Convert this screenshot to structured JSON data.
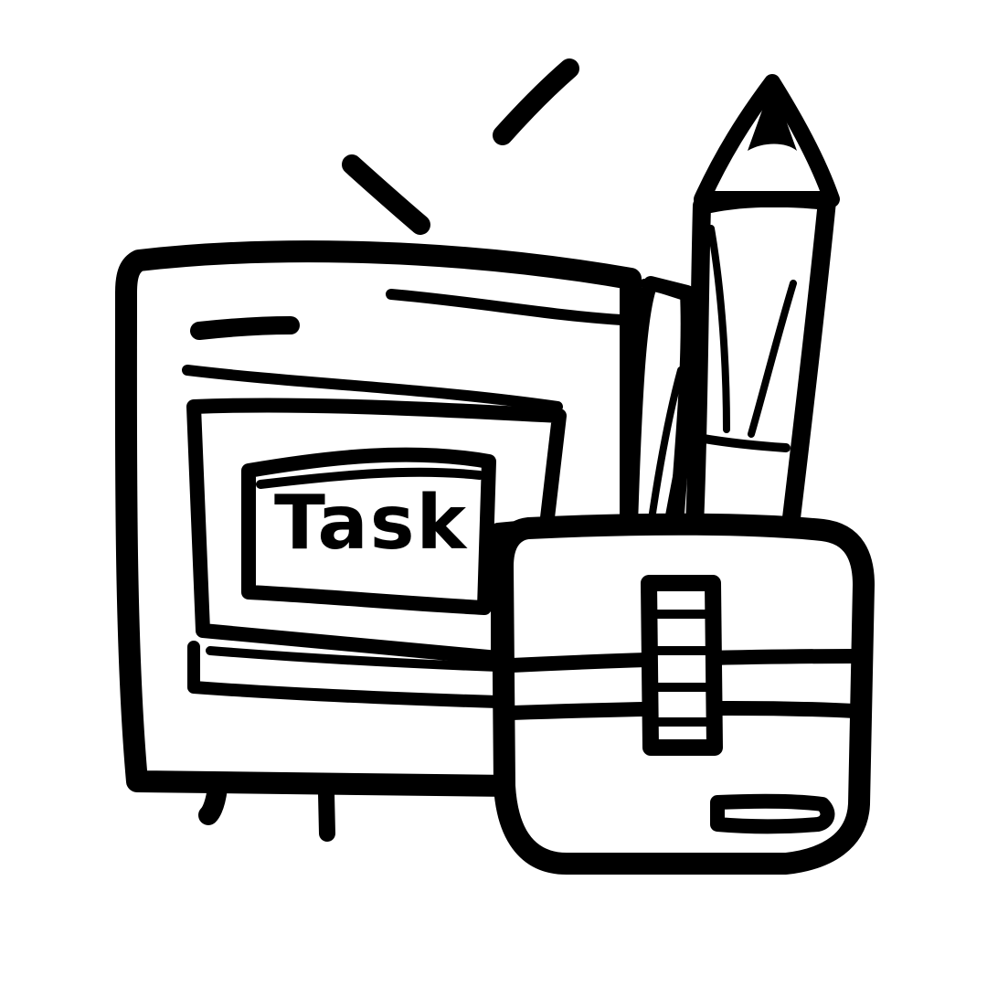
{
  "illustration": {
    "card_label": "Task",
    "colors": {
      "ink": "#000000",
      "paper": "#ffffff"
    },
    "icons": [
      "notebook-icon",
      "pencil-icon",
      "pencil-case-icon",
      "motion-lines-icon"
    ]
  }
}
